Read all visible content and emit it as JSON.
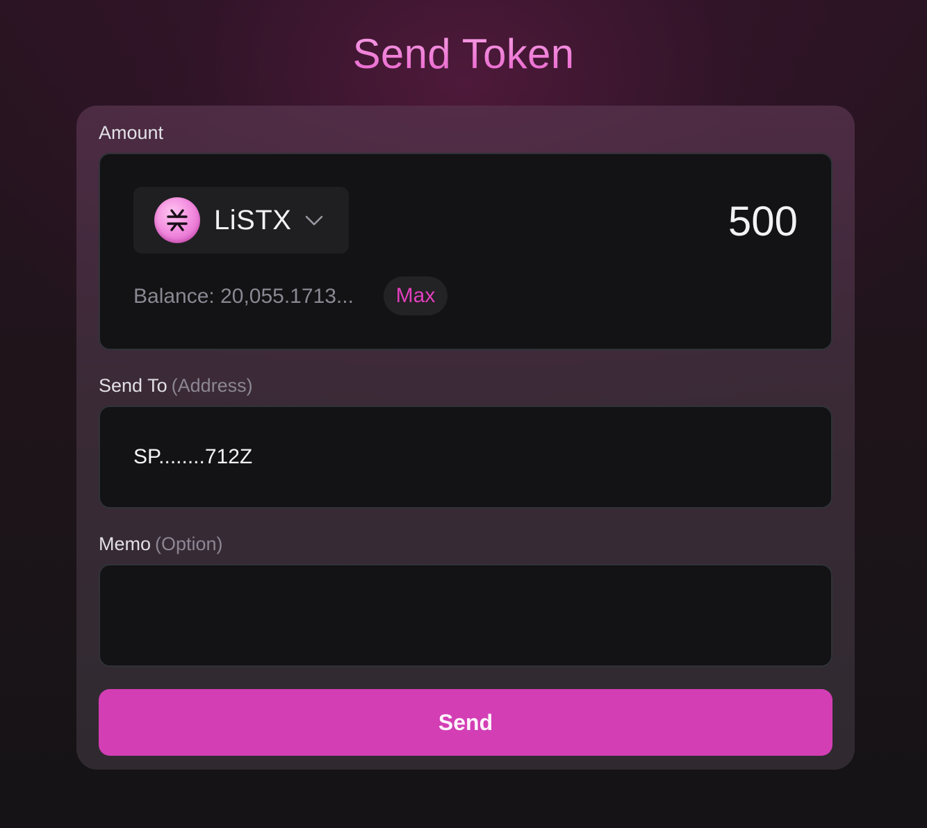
{
  "page": {
    "title": "Send Token"
  },
  "amount": {
    "label": "Amount",
    "token": {
      "symbol": "LiSTX",
      "icon": "stacks-logo-icon",
      "dropdown_icon": "chevron-down-icon"
    },
    "value": "500",
    "balance_text": "Balance: 20,055.1713...",
    "max_label": "Max"
  },
  "send_to": {
    "label": "Send To",
    "hint": "(Address)",
    "value": "SP........712Z"
  },
  "memo": {
    "label": "Memo",
    "hint": "(Option)",
    "value": ""
  },
  "actions": {
    "send_label": "Send"
  },
  "colors": {
    "accent": "#d33eb5",
    "title_gradient_top": "#f7a4e6",
    "title_gradient_bottom": "#e85fcb",
    "field_background": "#131214",
    "muted_text": "#8a8892"
  }
}
